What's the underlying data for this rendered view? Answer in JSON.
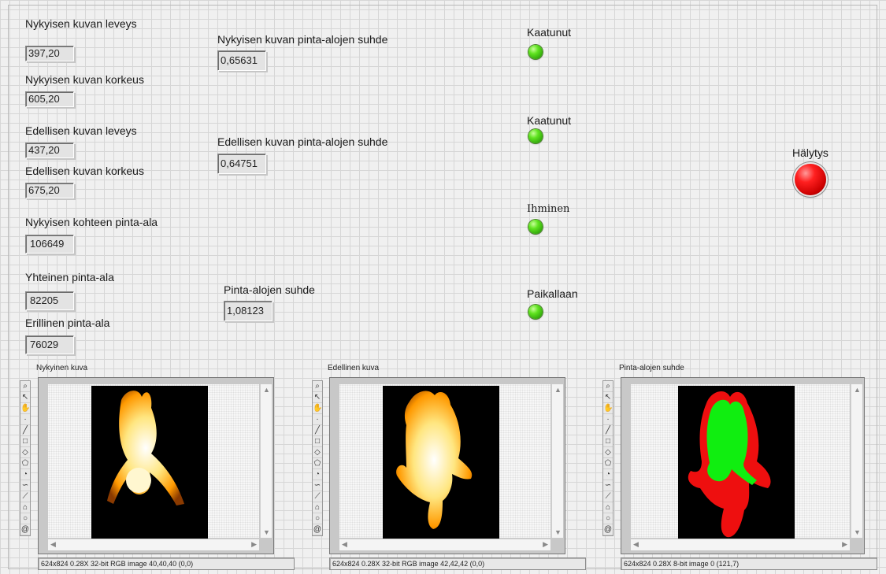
{
  "labels": {
    "current_width": "Nykyisen kuvan leveys",
    "current_height": "Nykyisen kuvan korkeus",
    "prev_width": "Edellisen kuvan leveys",
    "prev_height": "Edellisen kuvan korkeus",
    "current_target_area": "Nykyisen kohteen pinta-ala",
    "common_area": "Yhteinen pinta-ala",
    "separate_area": "Erillinen pinta-ala",
    "current_area_ratio": "Nykyisen kuvan pinta-alojen suhde",
    "prev_area_ratio": "Edellisen kuvan pinta-alojen suhde",
    "area_ratio": "Pinta-alojen suhde"
  },
  "values": {
    "current_width": "397,20",
    "current_height": "605,20",
    "prev_width": "437,20",
    "prev_height": "675,20",
    "current_target_area": "106649",
    "common_area": "82205",
    "separate_area": "76029",
    "current_area_ratio": "0,65631",
    "prev_area_ratio": "0,64751",
    "area_ratio": "1,08123"
  },
  "indicators": [
    {
      "label": "Kaatunut",
      "color": "#3cc80c"
    },
    {
      "label": "Kaatunut",
      "color": "#3cc80c"
    },
    {
      "label": "Ihminen",
      "color": "#3cc80c"
    },
    {
      "label": "Paikallaan",
      "color": "#3cc80c"
    }
  ],
  "alarm": {
    "label": "Hälytys",
    "color": "#e00000"
  },
  "displays": [
    {
      "title": "Nykyinen kuva",
      "status": "624x824 0.28X 32-bit RGB image 40,40,40    (0,0)"
    },
    {
      "title": "Edellinen kuva",
      "status": "624x824 0.28X 32-bit RGB image 42,42,42    (0,0)"
    },
    {
      "title": "Pinta-alojen suhde",
      "status": "624x824 0.28X 8-bit image 0    (121,7)"
    }
  ],
  "tools": [
    "zoom-icon",
    "pointer-icon",
    "pan-icon",
    "point-icon",
    "line-icon",
    "rectangle-icon",
    "rotated-rect-icon",
    "polygon-icon",
    "annulus-icon",
    "freehand-icon",
    "broken-line-icon",
    "polyline-icon",
    "oval-icon",
    "spiral-icon"
  ]
}
